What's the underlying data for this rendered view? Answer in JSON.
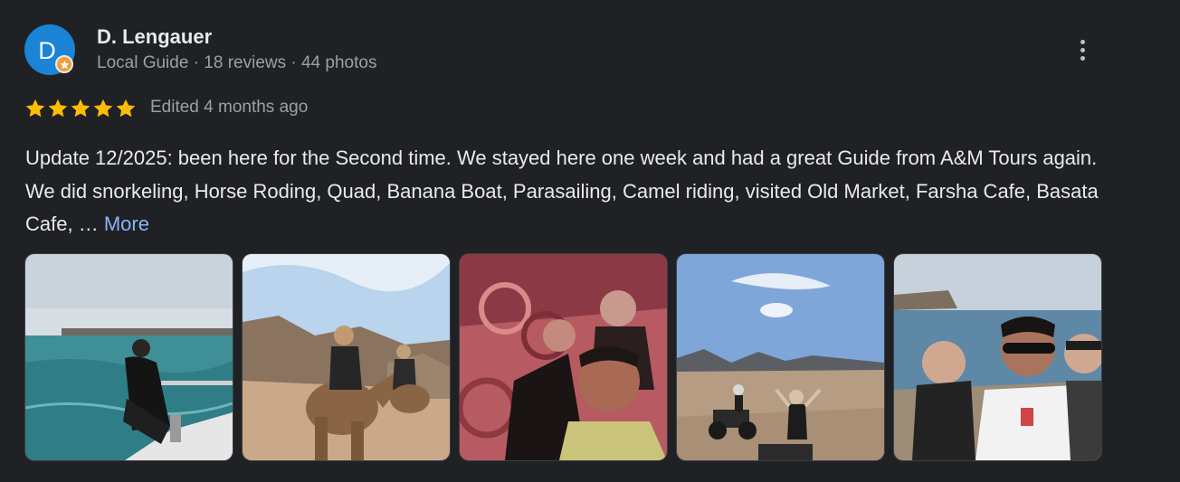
{
  "reviewer": {
    "initial": "D",
    "name": "D. Lengauer",
    "meta": "Local Guide · 18 reviews · 44 photos",
    "avatar_color": "#1a84d6",
    "badge_color": "#f29d39"
  },
  "menu": {
    "icon": "more-vert-icon"
  },
  "rating": {
    "stars": 5,
    "max": 5,
    "star_color": "#fbbc04"
  },
  "edited": "Edited 4 months ago",
  "review": {
    "text": "Update 12/2025: been here for the Second time. We stayed here one week and had a great Guide from A&M Tours again. We did snorkeling, Horse Roding, Quad, Banana Boat, Parasailing, Camel riding, visited Old Market, Farsha Cafe, Basata Cafe, …",
    "more_label": "More",
    "link_color": "#8ab4f8"
  },
  "photos": {
    "count": 5
  }
}
